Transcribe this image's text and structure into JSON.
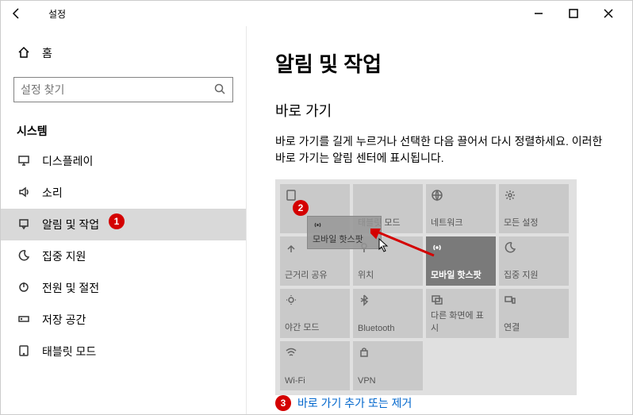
{
  "window": {
    "title": "설정"
  },
  "sidebar": {
    "home": "홈",
    "search_placeholder": "설정 찾기",
    "category": "시스템",
    "items": [
      {
        "label": "디스플레이"
      },
      {
        "label": "소리"
      },
      {
        "label": "알림 및 작업"
      },
      {
        "label": "집중 지원"
      },
      {
        "label": "전원 및 절전"
      },
      {
        "label": "저장 공간"
      },
      {
        "label": "태블릿 모드"
      }
    ]
  },
  "main": {
    "title": "알림 및 작업",
    "subtitle": "바로 가기",
    "desc": "바로 가기를 길게 누르거나 선택한 다음 끌어서 다시 정렬하세요. 이러한 바로 가기는 알림 센터에 표시됩니다.",
    "tiles": [
      {
        "label": "태블릿 모드"
      },
      {
        "label": "네트워크"
      },
      {
        "label": "모든 설정"
      },
      {
        "label": "근거리 공유"
      },
      {
        "label": "위치"
      },
      {
        "label": "모바일 핫스팟"
      },
      {
        "label": "집중 지원"
      },
      {
        "label": "야간 모드"
      },
      {
        "label": "Bluetooth"
      },
      {
        "label": "다른 화면에 표시"
      },
      {
        "label": "연결"
      },
      {
        "label": "Wi-Fi"
      },
      {
        "label": "VPN"
      }
    ],
    "ghost_label": "모바일 핫스팟",
    "link": "바로 가기 추가 또는 제거"
  },
  "annotations": {
    "a1": "1",
    "a2": "2",
    "a3": "3"
  }
}
